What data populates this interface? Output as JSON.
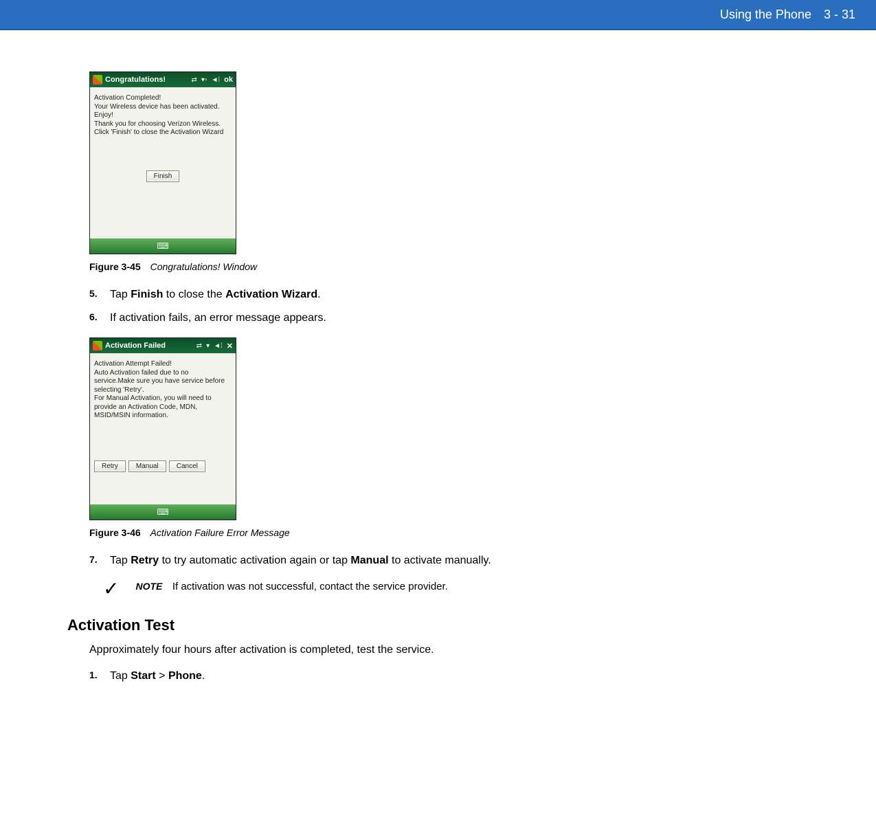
{
  "header": {
    "chapter": "Using the Phone",
    "page": "3 - 31"
  },
  "phone1": {
    "title": "Congratulations!",
    "icons": {
      "conn": "⇄",
      "signal": "▾▫",
      "speaker": "◄⁞",
      "ok": "ok"
    },
    "msg": {
      "l1": "Activation Completed!",
      "l2": "Your Wireless device has been activated.",
      "l3": "Enjoy!",
      "l4": "Thank you for choosing Verizon Wireless.",
      "l5": "Click 'Finish' to close the Activation Wizard"
    },
    "btn_finish": "Finish"
  },
  "fig45": {
    "label": "Figure 3-45",
    "title": "Congratulations! Window"
  },
  "steps_a": {
    "s5": {
      "num": "5.",
      "pre": "Tap ",
      "b1": "Finish",
      "mid": " to close the ",
      "b2": "Activation Wizard",
      "post": "."
    },
    "s6": {
      "num": "6.",
      "text": "If activation fails, an error message appears."
    }
  },
  "phone2": {
    "title": "Activation Failed",
    "icons": {
      "conn": "⇄",
      "signal": "▾",
      "speaker": "◄⁞",
      "close": "✕"
    },
    "msg": {
      "l1": "Activation Attempt Failed!",
      "l2": "Auto Activation failed due to no",
      "l3": "service.Make sure you have service before",
      "l4": "selecting 'Retry'.",
      "l5": "For Manual Activation, you will need to",
      "l6": "provide an Activation Code, MDN,",
      "l7": "MSID/MSIN information."
    },
    "btn_retry": "Retry",
    "btn_manual": "Manual",
    "btn_cancel": "Cancel"
  },
  "fig46": {
    "label": "Figure 3-46",
    "title": "Activation Failure Error Message"
  },
  "steps_b": {
    "s7": {
      "num": "7.",
      "pre": "Tap ",
      "b1": "Retry",
      "mid": " to try automatic activation again or tap ",
      "b2": "Manual",
      "post": " to activate manually."
    }
  },
  "note": {
    "label": "NOTE",
    "text": "If activation was not successful, contact the service provider."
  },
  "section": {
    "heading": "Activation Test"
  },
  "intro": "Approximately four hours after activation is completed, test the service.",
  "steps_c": {
    "s1": {
      "num": "1.",
      "pre": "Tap ",
      "b1": "Start",
      "sep": " > ",
      "b2": "Phone",
      "post": "."
    }
  }
}
